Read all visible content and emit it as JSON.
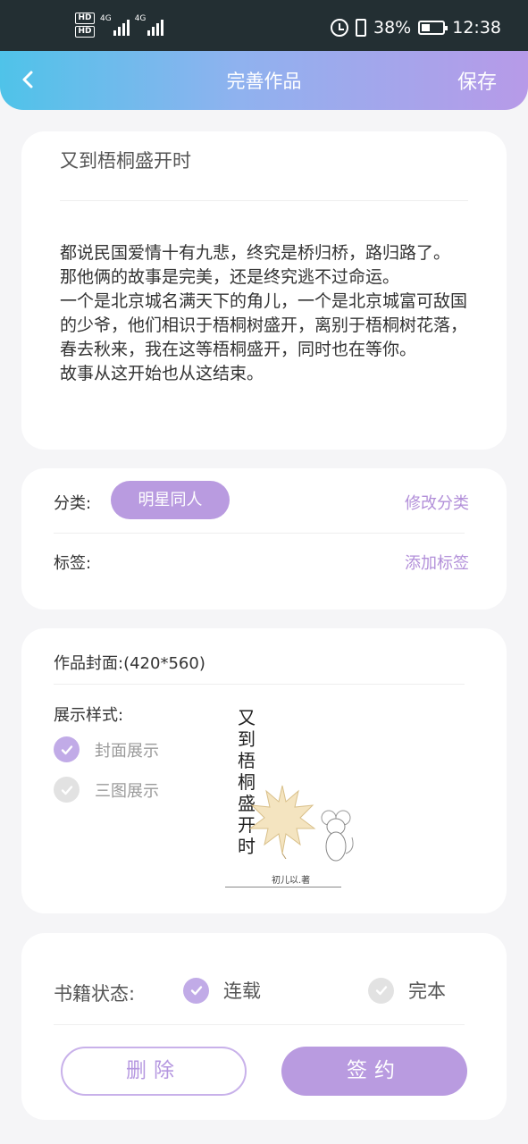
{
  "status_bar": {
    "hd_top": "HD",
    "hd_bottom": "HD",
    "net1": "4G",
    "net2": "4G",
    "battery_pct": "38%",
    "time": "12:38"
  },
  "header": {
    "title": "完善作品",
    "save_label": "保存"
  },
  "work": {
    "title": "又到梧桐盛开时",
    "synopsis": "都说民国爱情十有九悲，终究是桥归桥，路归路了。\n那他俩的故事是完美，还是终究逃不过命运。\n一个是北京城名满天下的角儿，一个是北京城富可敌国的少爷，他们相识于梧桐树盛开，离别于梧桐树花落，春去秋来，我在这等梧桐盛开，同时也在等你。\n故事从这开始也从这结束。"
  },
  "category": {
    "label": "分类:",
    "value": "明星同人",
    "edit_label": "修改分类"
  },
  "tags": {
    "label": "标签:",
    "add_label": "添加标签"
  },
  "cover": {
    "label": "作品封面:",
    "size": "(420*560)",
    "display_label": "展示样式:",
    "options": [
      {
        "label": "封面展示",
        "checked": true
      },
      {
        "label": "三图展示",
        "checked": false
      }
    ],
    "image_title": "又到梧桐盛开时",
    "image_author": "初儿以.著"
  },
  "book_status": {
    "label": "书籍状态:",
    "options": [
      {
        "label": "连载",
        "checked": true
      },
      {
        "label": "完本",
        "checked": false
      }
    ]
  },
  "actions": {
    "delete_label": "删除",
    "sign_label": "签约"
  },
  "colors": {
    "accent": "#b99be0",
    "header_start": "#4fc3e9",
    "header_end": "#b79ae8"
  }
}
